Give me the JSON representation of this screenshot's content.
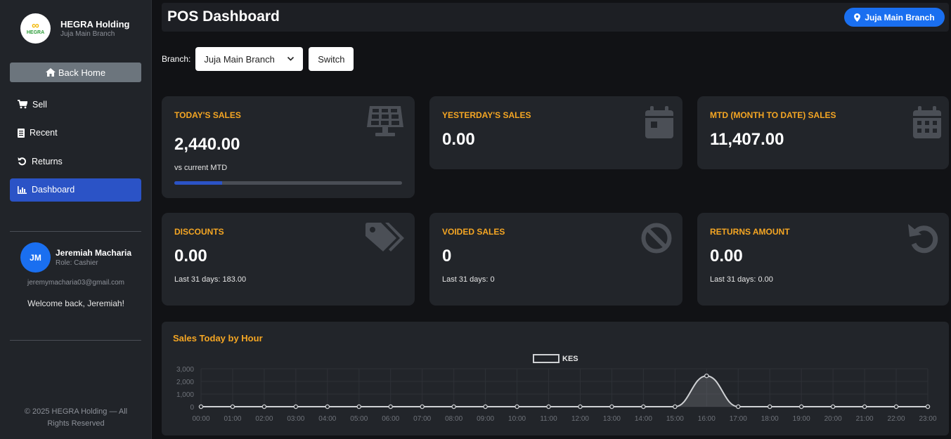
{
  "sidebar": {
    "brand_name": "HEGRA Holding",
    "brand_sub": "Juja Main Branch",
    "logo_text": "HEGRA",
    "back_home": "Back Home",
    "nav": [
      {
        "label": "Sell",
        "icon": "cart-icon"
      },
      {
        "label": "Recent",
        "icon": "receipt-icon"
      },
      {
        "label": "Returns",
        "icon": "undo-icon"
      },
      {
        "label": "Dashboard",
        "icon": "bar-chart-icon",
        "active": true
      }
    ],
    "user": {
      "initials": "JM",
      "name": "Jeremiah Macharia",
      "role": "Role: Cashier",
      "email": "jeremymacharia03@gmail.com",
      "welcome": "Welcome back, Jeremiah!"
    },
    "copyright": "© 2025 HEGRA Holding — All Rights Reserved"
  },
  "header": {
    "title": "POS Dashboard",
    "branch_badge": "Juja Main Branch"
  },
  "branch_switch": {
    "label": "Branch:",
    "selected": "Juja Main Branch",
    "button": "Switch"
  },
  "cards": {
    "today": {
      "title": "TODAY'S SALES",
      "value": "2,440.00",
      "sub": "vs current MTD",
      "progress": 0.21
    },
    "yesterday": {
      "title": "YESTERDAY'S SALES",
      "value": "0.00"
    },
    "mtd": {
      "title": "MTD (MONTH TO DATE) SALES",
      "value": "11,407.00"
    },
    "discounts": {
      "title": "DISCOUNTS",
      "value": "0.00",
      "sub": "Last 31 days: 183.00"
    },
    "voided": {
      "title": "VOIDED SALES",
      "value": "0",
      "sub": "Last 31 days: 0"
    },
    "returns": {
      "title": "RETURNS AMOUNT",
      "value": "0.00",
      "sub": "Last 31 days: 0.00"
    }
  },
  "colors": {
    "accent": "#f5a623",
    "primary": "#1a6ff0",
    "active_nav": "#2b53c6"
  },
  "chart_title": "Sales Today by Hour",
  "chart_data": {
    "type": "line",
    "title": "Sales Today by Hour",
    "series": [
      {
        "name": "KES",
        "values": [
          0,
          0,
          0,
          0,
          0,
          0,
          0,
          0,
          0,
          0,
          0,
          0,
          0,
          0,
          0,
          0,
          2440,
          0,
          0,
          0,
          0,
          0,
          0,
          0
        ]
      }
    ],
    "x": [
      "00:00",
      "01:00",
      "02:00",
      "03:00",
      "04:00",
      "05:00",
      "06:00",
      "07:00",
      "08:00",
      "09:00",
      "10:00",
      "11:00",
      "12:00",
      "13:00",
      "14:00",
      "15:00",
      "16:00",
      "17:00",
      "18:00",
      "19:00",
      "20:00",
      "21:00",
      "22:00",
      "23:00"
    ],
    "yticks": [
      "0",
      "1,000",
      "2,000",
      "3,000"
    ],
    "ylim": [
      0,
      3000
    ],
    "legend": "top-center",
    "grid": true
  }
}
